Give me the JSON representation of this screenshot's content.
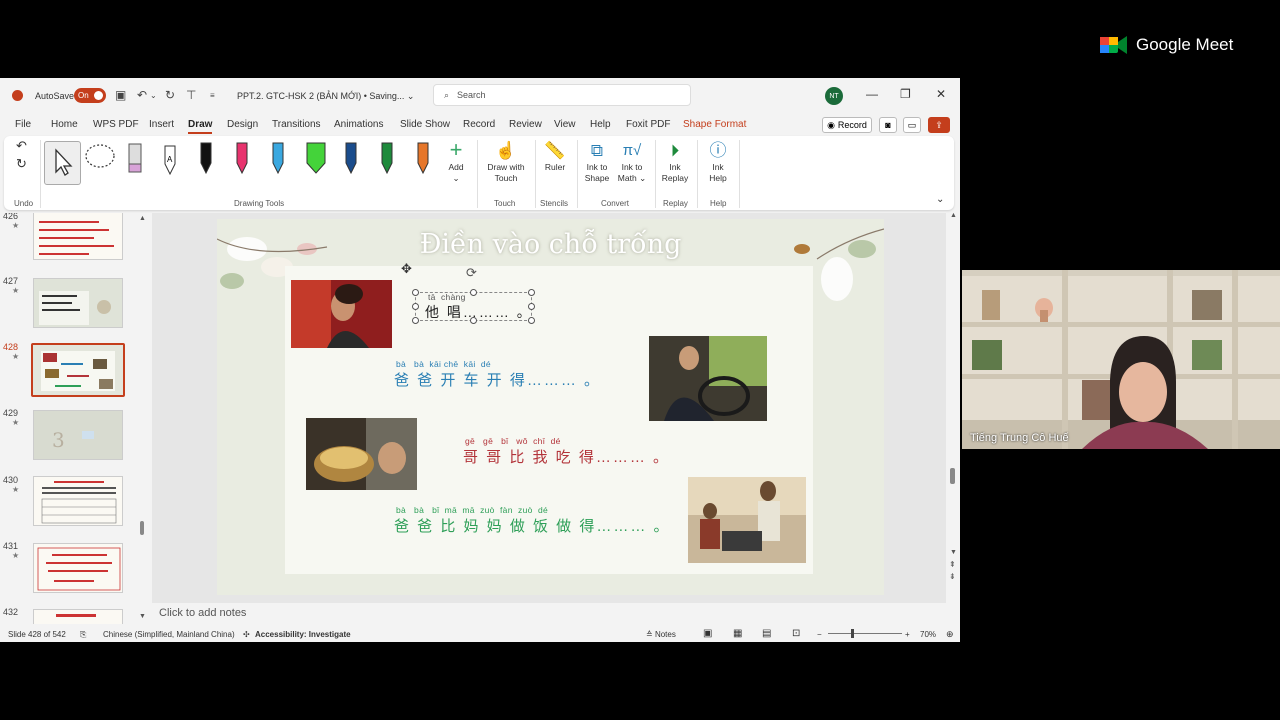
{
  "meet": {
    "brand": "Google Meet",
    "participant_name": "Tiếng Trung Cô Huế"
  },
  "titlebar": {
    "autosave_label": "AutoSave",
    "autosave_state": "On",
    "doc_title": "PPT.2. GTC-HSK 2 (BẢN MỚI) • Saving...",
    "search_placeholder": "Search",
    "avatar_initials": "NT"
  },
  "tabs": [
    "File",
    "Home",
    "WPS PDF",
    "Insert",
    "Draw",
    "Design",
    "Transitions",
    "Animations",
    "Slide Show",
    "Record",
    "Review",
    "View",
    "Help",
    "Foxit PDF",
    "Shape Format"
  ],
  "active_tab": "Draw",
  "record_button": "Record",
  "ribbon": {
    "undo_label": "Undo",
    "drawing_tools_label": "Drawing Tools",
    "add_label": "Add",
    "draw_with_touch_1": "Draw with",
    "draw_with_touch_2": "Touch",
    "touch_label": "Touch",
    "ruler_label": "Ruler",
    "stencils_label": "Stencils",
    "ink_to_shape_1": "Ink to",
    "ink_to_shape_2": "Shape",
    "ink_to_math_1": "Ink to",
    "ink_to_math_2": "Math",
    "convert_label": "Convert",
    "ink_replay_1": "Ink",
    "ink_replay_2": "Replay",
    "replay_label": "Replay",
    "ink_help_1": "Ink",
    "ink_help_2": "Help",
    "help_label": "Help",
    "pen_colors": [
      "#111111",
      "#e8336e",
      "#3aa8e0",
      "#44d33a",
      "#1a4c8c",
      "#1e8a3c",
      "#e6762a"
    ]
  },
  "thumbnails": [
    {
      "num": "426",
      "active": false
    },
    {
      "num": "427",
      "active": false
    },
    {
      "num": "428",
      "active": true
    },
    {
      "num": "429",
      "active": false
    },
    {
      "num": "430",
      "active": false
    },
    {
      "num": "431",
      "active": false
    },
    {
      "num": "432",
      "active": false
    }
  ],
  "slide": {
    "title": "Điền vào chỗ trống",
    "line1_pinyin": "tā  chàng",
    "line1_hanzi": "他 唱……… 。",
    "line2_pinyin": "bà   bà  kāi chē  kāi  dé",
    "line2_hanzi": "爸 爸 开 车 开 得……… 。",
    "line3_pinyin": "gē   gē   bǐ   wǒ  chī  dé",
    "line3_hanzi": "哥 哥 比 我 吃 得……… 。",
    "line4_pinyin": "bà   bà   bǐ  mā  mā  zuò  fàn  zuò  dé",
    "line4_hanzi": "爸 爸 比 妈 妈 做 饭 做 得……… 。"
  },
  "notes_placeholder": "Click to add notes",
  "statusbar": {
    "slide_info": "Slide 428 of 542",
    "language": "Chinese (Simplified, Mainland China)",
    "accessibility": "Accessibility: Investigate",
    "notes": "Notes",
    "zoom": "70%"
  }
}
